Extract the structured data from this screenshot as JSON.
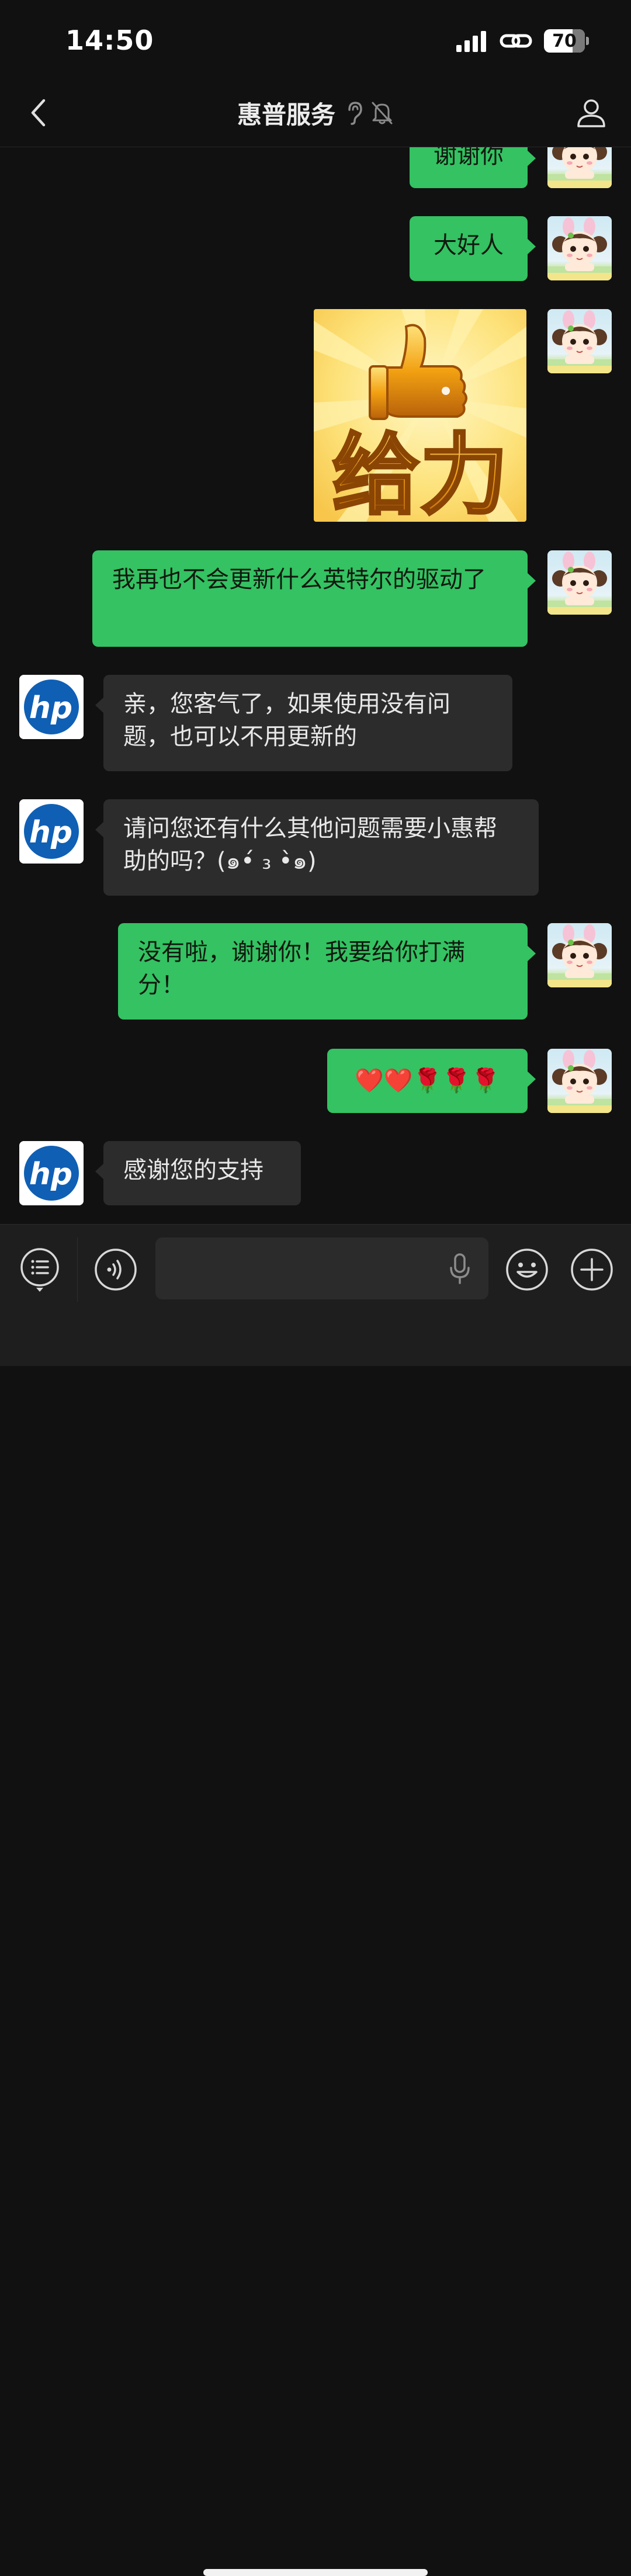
{
  "status_bar": {
    "time": "14:50",
    "battery": "70",
    "battery_level_percent": 70
  },
  "nav": {
    "title": "惠普服务"
  },
  "messages": [
    {
      "sender": "me",
      "type": "text",
      "text": "谢谢你"
    },
    {
      "sender": "me",
      "type": "text",
      "text": "大好人"
    },
    {
      "sender": "me",
      "type": "sticker",
      "text": "给力"
    },
    {
      "sender": "me",
      "type": "text",
      "text": "我再也不会更新什么英特尔的驱动了"
    },
    {
      "sender": "hp",
      "type": "text",
      "text": "亲，您客气了，如果使用没有问题，也可以不用更新的"
    },
    {
      "sender": "hp",
      "type": "text",
      "text": "请问您还有什么其他问题需要小惠帮助的吗？(๑•́ ₃ •̀๑)"
    },
    {
      "sender": "me",
      "type": "text",
      "text": "没有啦，谢谢你！我要给你打满分！"
    },
    {
      "sender": "me",
      "type": "text",
      "text": "❤️❤️🌹🌹🌹"
    },
    {
      "sender": "hp",
      "type": "text",
      "text": "感谢您的支持"
    }
  ],
  "hp_logo_text": "hp",
  "input_bar": {
    "placeholder": ""
  },
  "colors": {
    "background": "#111111",
    "my_bubble": "#34c262",
    "their_bubble": "#2c2c2c",
    "hp_blue": "#0f5fb5"
  }
}
